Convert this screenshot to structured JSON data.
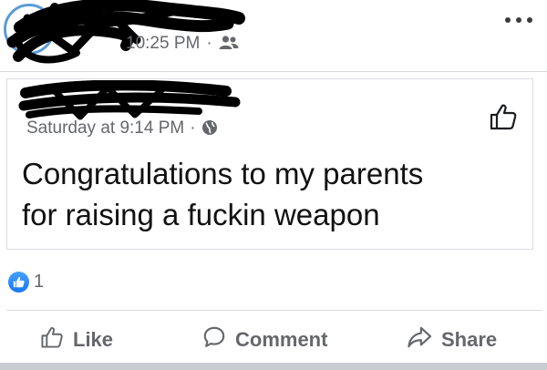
{
  "outer_post": {
    "timestamp": "10:25 PM",
    "separator": "·",
    "audience_icon": "friends-icon",
    "more_icon": "more-options-icon"
  },
  "shared_post": {
    "timestamp": "Saturday at 9:14 PM",
    "separator": "·",
    "audience_icon": "globe-icon",
    "text": "Congratulations to my parents\nfor raising a fuckin weapon"
  },
  "reactions": {
    "count": "1",
    "icon": "like-reaction-icon"
  },
  "actions": {
    "like_label": "Like",
    "comment_label": "Comment",
    "share_label": "Share"
  },
  "colors": {
    "accent": "#1877f2",
    "muted_text": "#65676b",
    "text": "#111111"
  }
}
